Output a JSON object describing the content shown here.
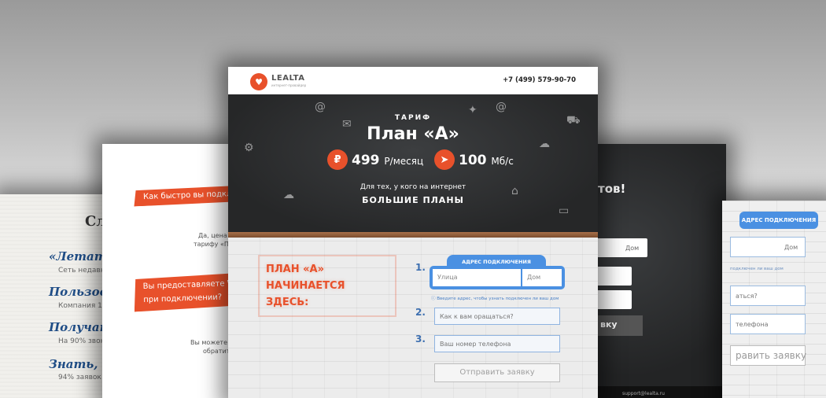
{
  "left_card": {
    "title": "Сл",
    "items": [
      {
        "label": "«Летать",
        "sub": "Сеть недавн"
      },
      {
        "label": "Пользова",
        "sub": "Компания 10"
      },
      {
        "label": "Получать",
        "sub": "На 90% звонк"
      },
      {
        "label": "Знать, чт",
        "sub": "94% заявок к"
      }
    ]
  },
  "left_card2": {
    "q1": "Как быстро вы подклю",
    "a1_line1": "Да, цена а",
    "a1_line2": "тарифу «Пл",
    "q2_line1": "Вы предоставляете Wi",
    "q2_line2": "при подключении?",
    "a2_line1": "Вы можете з",
    "a2_line2": "обратит"
  },
  "main": {
    "brand": "LEALTA",
    "brand_sub": "интернет-провайдер",
    "phone": "+7 (499) 579-90-70",
    "hero": {
      "tag": "ТАРИФ",
      "plan": "План «А»",
      "price_icon": "₽",
      "price": "499",
      "price_unit": "Р/месяц",
      "speed_icon": "➤",
      "speed": "100",
      "speed_unit": "Мб/с",
      "for_line": "Для тех, у кого на интернет",
      "big_line": "БОЛЬШИЕ ПЛАНЫ"
    },
    "form": {
      "stamp_line1": "ПЛАН «А»",
      "stamp_line2": "НАЧИНАЕТСЯ ЗДЕСЬ:",
      "step1": "1.",
      "step2": "2.",
      "step3": "3.",
      "address_tab": "АДРЕС ПОДКЛЮЧЕНИЯ",
      "street_placeholder": "Улица",
      "house_placeholder": "Дом",
      "note": "Введите адрес, чтобы узнать подключен ли ваш дом",
      "name_placeholder": "Как к вам оращаться?",
      "phone_placeholder": "Ваш номер телефона",
      "submit": "Отправить заявку"
    }
  },
  "right_card1": {
    "title": "тов!",
    "dom1": "Дом",
    "button": "вку",
    "footer_text": "support@lealta.ru"
  },
  "right_card2": {
    "tab": "АДРЕС ПОДКЛЮЧЕНИЯ",
    "dom": "Дом",
    "note": "подключен ли ваш дом",
    "field1": "аться?",
    "field2": "телефона",
    "button": "равить заявку"
  }
}
